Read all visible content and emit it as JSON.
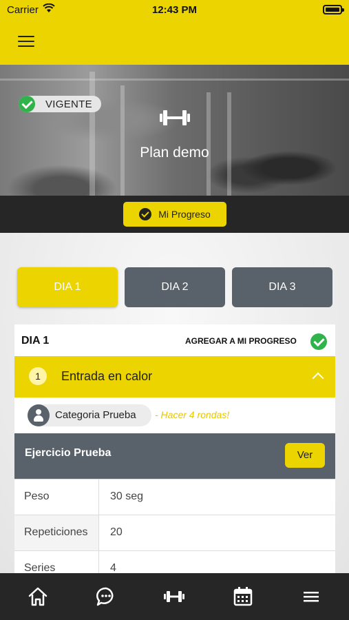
{
  "status_bar": {
    "carrier": "Carrier",
    "time": "12:43 PM"
  },
  "hero": {
    "status_badge": "VIGENTE",
    "plan_title": "Plan demo"
  },
  "progress_button": {
    "label": "Mi Progreso"
  },
  "day_tabs": [
    {
      "label": "DIA 1",
      "active": true
    },
    {
      "label": "DIA 2",
      "active": false
    },
    {
      "label": "DIA 3",
      "active": false
    }
  ],
  "day_card": {
    "title": "DIA 1",
    "add_to_progress_label": "AGREGAR A MI PROGRESO",
    "section": {
      "number": "1",
      "title": "Entrada en calor",
      "category": "Categoria Prueba",
      "note": "- Hacer 4 rondas!",
      "exercise": {
        "title": "Ejercicio Prueba",
        "view_button": "Ver",
        "rows": [
          {
            "key": "Peso",
            "value": "30 seg"
          },
          {
            "key": "Repeticiones",
            "value": "20"
          },
          {
            "key": "Series",
            "value": "4"
          }
        ]
      }
    }
  },
  "bottom_nav": [
    "home-icon",
    "chat-icon",
    "dumbbell-icon",
    "calendar-icon",
    "menu-icon"
  ],
  "colors": {
    "accent": "#ecd400",
    "dark": "#262626",
    "slate": "#59616b",
    "success": "#2fb34a",
    "note": "#e6c800"
  }
}
